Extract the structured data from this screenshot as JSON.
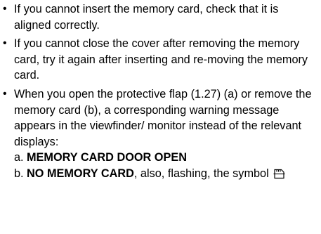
{
  "bullets": [
    {
      "text": "If you cannot insert the memory card, check that it is aligned correctly."
    },
    {
      "text": "If you cannot close the cover after removing the memory card, try it again after inserting and re-moving the memory card."
    },
    {
      "text": "When you open the protective flap (1.27) (a) or remove the memory card (b), a corresponding warning message appears in the viewfinder/ monitor instead of the relevant displays:"
    }
  ],
  "sub_items": [
    {
      "letter": "a.",
      "bold": "MEMORY CARD DOOR OPEN",
      "rest": ""
    },
    {
      "letter": "b.",
      "bold": "NO MEMORY CARD",
      "rest": ", also, flashing, the symbol"
    }
  ],
  "bullet_glyph": "•",
  "icons": {
    "card_symbol": "memory-card-icon"
  }
}
